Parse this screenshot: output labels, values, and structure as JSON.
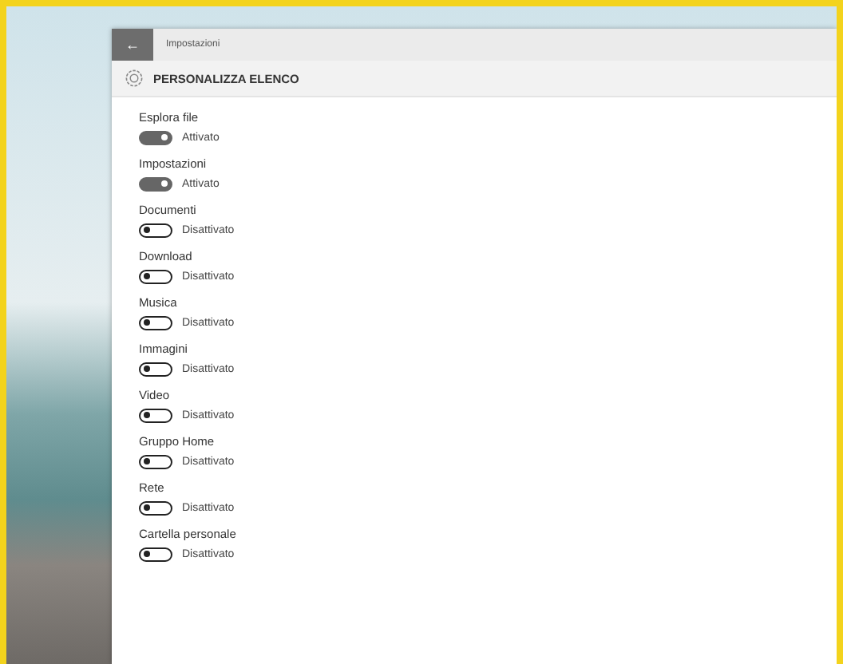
{
  "window": {
    "title": "Impostazioni",
    "back_button": "←"
  },
  "header": {
    "title": "PERSONALIZZA ELENCO"
  },
  "settings": [
    {
      "label": "Esplora file",
      "on": true,
      "state_text": "Attivato"
    },
    {
      "label": "Impostazioni",
      "on": true,
      "state_text": "Attivato"
    },
    {
      "label": "Documenti",
      "on": false,
      "state_text": "Disattivato"
    },
    {
      "label": "Download",
      "on": false,
      "state_text": "Disattivato"
    },
    {
      "label": "Musica",
      "on": false,
      "state_text": "Disattivato"
    },
    {
      "label": "Immagini",
      "on": false,
      "state_text": "Disattivato"
    },
    {
      "label": "Video",
      "on": false,
      "state_text": "Disattivato"
    },
    {
      "label": "Gruppo Home",
      "on": false,
      "state_text": "Disattivato"
    },
    {
      "label": "Rete",
      "on": false,
      "state_text": "Disattivato"
    },
    {
      "label": "Cartella personale",
      "on": false,
      "state_text": "Disattivato"
    }
  ]
}
